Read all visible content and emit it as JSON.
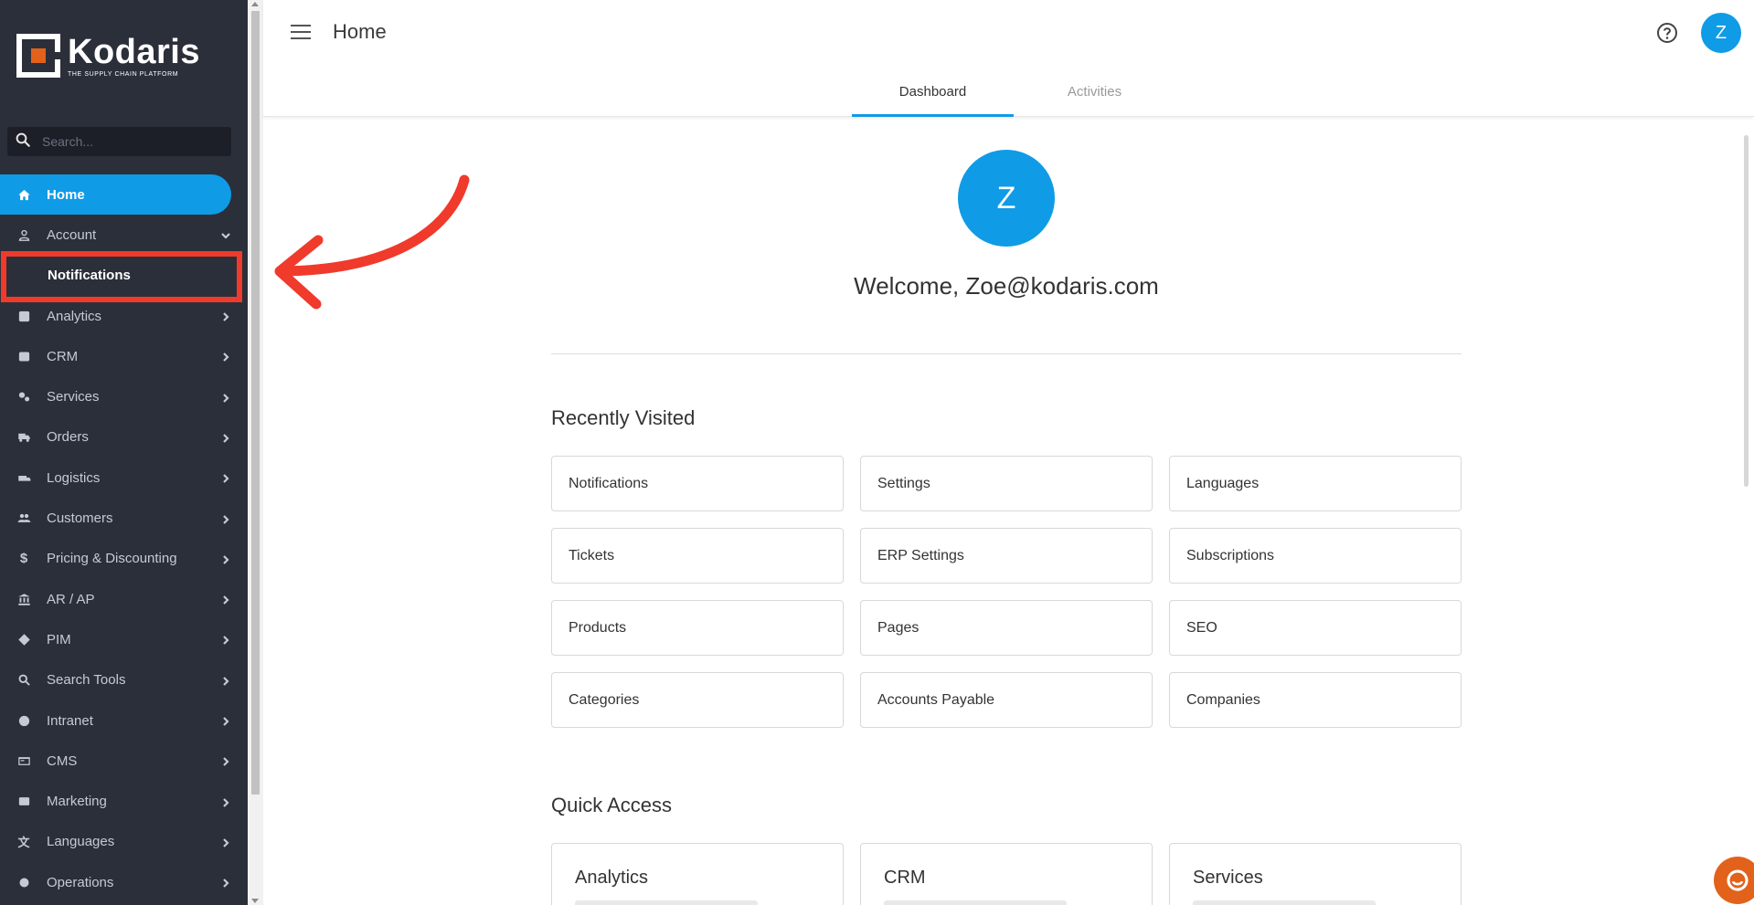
{
  "brand": {
    "name": "Kodaris",
    "tagline": "THE SUPPLY CHAIN PLATFORM",
    "accent": "#0f9be6",
    "orange": "#e2621b"
  },
  "sidebar": {
    "search_placeholder": "Search...",
    "items": [
      {
        "label": "Home",
        "icon": "home-icon",
        "active": true
      },
      {
        "label": "Account",
        "icon": "person-icon",
        "expanded": true
      },
      {
        "label": "Notifications",
        "sub": true
      },
      {
        "label": "Analytics",
        "icon": "analytics-icon"
      },
      {
        "label": "CRM",
        "icon": "crm-icon"
      },
      {
        "label": "Services",
        "icon": "services-icon"
      },
      {
        "label": "Orders",
        "icon": "truck-icon"
      },
      {
        "label": "Logistics",
        "icon": "logistics-icon"
      },
      {
        "label": "Customers",
        "icon": "people-icon"
      },
      {
        "label": "Pricing & Discounting",
        "icon": "dollar-icon"
      },
      {
        "label": "AR / AP",
        "icon": "bank-icon"
      },
      {
        "label": "PIM",
        "icon": "tag-icon"
      },
      {
        "label": "Search Tools",
        "icon": "search-icon"
      },
      {
        "label": "Intranet",
        "icon": "globe-icon"
      },
      {
        "label": "CMS",
        "icon": "cms-icon"
      },
      {
        "label": "Marketing",
        "icon": "marketing-icon"
      },
      {
        "label": "Languages",
        "icon": "translate-icon"
      },
      {
        "label": "Operations",
        "icon": "operations-icon"
      }
    ]
  },
  "header": {
    "title": "Home",
    "avatar_initial": "Z",
    "tabs": [
      {
        "label": "Dashboard",
        "active": true
      },
      {
        "label": "Activities"
      }
    ]
  },
  "main": {
    "avatar_initial": "Z",
    "welcome": "Welcome, Zoe@kodaris.com",
    "recently_visited_title": "Recently Visited",
    "recently_visited": [
      "Notifications",
      "Settings",
      "Languages",
      "Tickets",
      "ERP Settings",
      "Subscriptions",
      "Products",
      "Pages",
      "SEO",
      "Categories",
      "Accounts Payable",
      "Companies"
    ],
    "quick_access_title": "Quick Access",
    "quick_access": [
      "Analytics",
      "CRM",
      "Services"
    ]
  },
  "annotation": {
    "color": "#f03a2b"
  }
}
